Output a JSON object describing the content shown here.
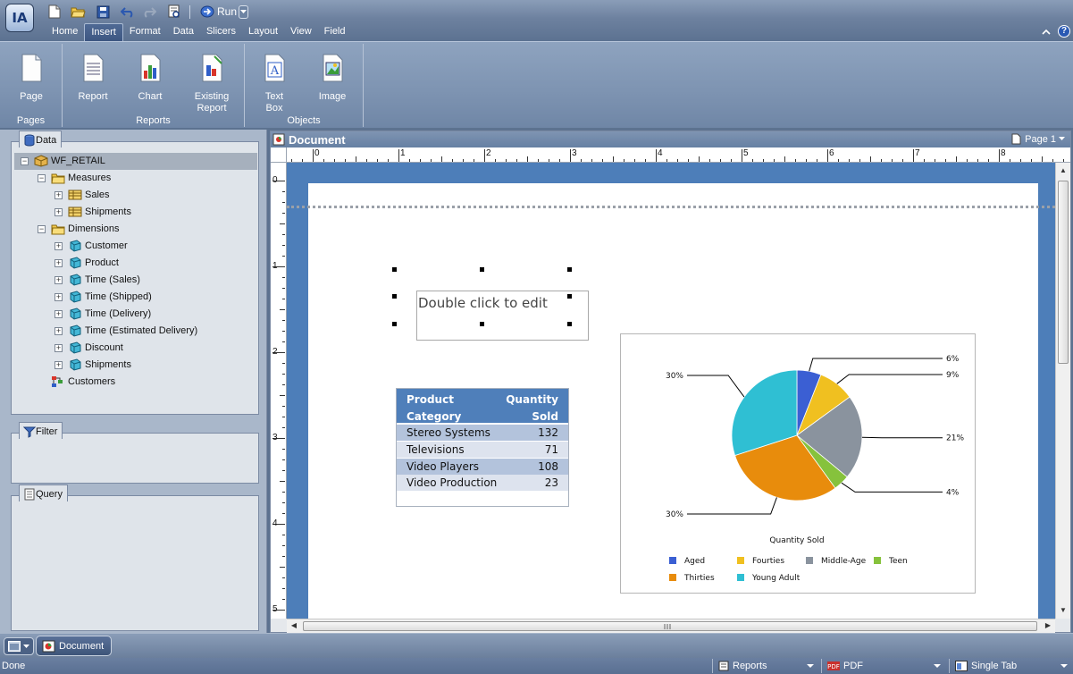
{
  "app": {
    "logo_text": "IA"
  },
  "toolbar": {
    "run_label": "Run"
  },
  "ribbon": {
    "tabs": [
      "Home",
      "Insert",
      "Format",
      "Data",
      "Slicers",
      "Layout",
      "View",
      "Field"
    ],
    "active_tab": "Insert",
    "groups": {
      "pages": {
        "label": "Pages",
        "buttons": {
          "page": "Page"
        }
      },
      "reports": {
        "label": "Reports",
        "buttons": {
          "report": "Report",
          "chart": "Chart",
          "existing_report": "Existing Report"
        }
      },
      "objects": {
        "label": "Objects",
        "buttons": {
          "text_box": "Text Box",
          "image": "Image"
        }
      }
    }
  },
  "left_panel": {
    "data_tab": "Data",
    "filter_tab": "Filter",
    "query_tab": "Query",
    "tree": {
      "root": "WF_RETAIL",
      "measures": {
        "label": "Measures",
        "items": [
          "Sales",
          "Shipments"
        ]
      },
      "dimensions": {
        "label": "Dimensions",
        "items": [
          "Customer",
          "Product",
          "Time (Sales)",
          "Time (Shipped)",
          "Time (Delivery)",
          "Time (Estimated Delivery)",
          "Discount",
          "Shipments"
        ]
      },
      "extra": "Customers"
    }
  },
  "document": {
    "title": "Document",
    "page_indicator": "Page 1",
    "ruler_h": [
      "0",
      "1",
      "2",
      "3",
      "4",
      "5",
      "6",
      "7",
      "8"
    ],
    "ruler_v": [
      "0",
      "1",
      "2",
      "3",
      "4",
      "5"
    ],
    "text_box": {
      "text": "Double click to edit"
    },
    "report_table": {
      "headers": {
        "category_line1": "Product",
        "category_line2": "Category",
        "value_line1": "Quantity",
        "value_line2": "Sold"
      },
      "rows": [
        {
          "category": "Stereo Systems",
          "value": "132"
        },
        {
          "category": "Televisions",
          "value": "71"
        },
        {
          "category": "Video Players",
          "value": "108"
        },
        {
          "category": "Video Production",
          "value": "23"
        }
      ]
    }
  },
  "chart_data": {
    "type": "pie",
    "title": "Quantity Sold",
    "slices": [
      {
        "label": "Aged",
        "value": 6,
        "display": "6%",
        "color": "#3b5fd3"
      },
      {
        "label": "Fourties",
        "value": 9,
        "display": "9%",
        "color": "#f0c020"
      },
      {
        "label": "Middle-Age",
        "value": 21,
        "display": "21%",
        "color": "#8a939e"
      },
      {
        "label": "Teen",
        "value": 4,
        "display": "4%",
        "color": "#86c23c"
      },
      {
        "label": "Thirties",
        "value": 30,
        "display": "30%",
        "color": "#e88c0c"
      },
      {
        "label": "Young Adult",
        "value": 30,
        "display": "30%",
        "color": "#2fbfd3"
      }
    ],
    "legend_position": "bottom"
  },
  "bottom": {
    "doc_tab": "Document"
  },
  "status": {
    "text": "Done",
    "output_type": "Reports",
    "format": "PDF",
    "layout_mode": "Single Tab"
  },
  "colors": {
    "accent": "#4f7fba",
    "canvas": "#4d7eb9"
  }
}
